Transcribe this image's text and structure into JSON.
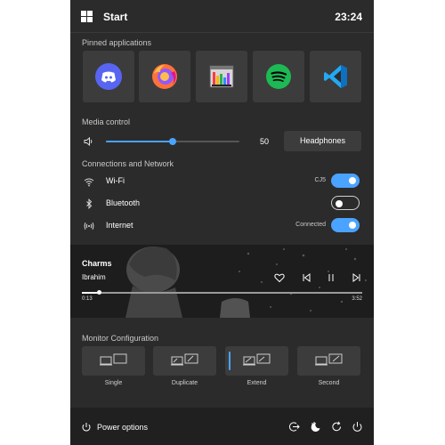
{
  "header": {
    "title": "Start",
    "time": "23:24",
    "icon": "windows-logo-icon"
  },
  "pinned": {
    "label": "Pinned applications",
    "apps": [
      {
        "name": "Discord",
        "icon": "discord-icon",
        "color": "#5865f2"
      },
      {
        "name": "Firefox",
        "icon": "firefox-icon",
        "color": "#ff7139"
      },
      {
        "name": "Task Manager",
        "icon": "task-manager-icon",
        "color": "#d6d6d6"
      },
      {
        "name": "Spotify",
        "icon": "spotify-icon",
        "color": "#1db954"
      },
      {
        "name": "Visual Studio Code",
        "icon": "vscode-icon",
        "color": "#23a9f2"
      }
    ]
  },
  "media": {
    "label": "Media control",
    "volume": 50,
    "volume_text": "50",
    "device": "Headphones"
  },
  "connections": {
    "label": "Connections and Network",
    "rows": [
      {
        "label": "Wi-Fi",
        "status": "CJ5",
        "on": true,
        "icon": "wifi-icon"
      },
      {
        "label": "Bluetooth",
        "status": "",
        "on": false,
        "icon": "bluetooth-icon"
      },
      {
        "label": "Internet",
        "status": "Connected",
        "on": true,
        "icon": "internet-icon"
      }
    ]
  },
  "player": {
    "song": "Charms",
    "artist": "Ibrahim",
    "current": "0:13",
    "total": "3:52",
    "progress": 0.06
  },
  "monitor": {
    "label": "Monitor Configuration",
    "options": [
      {
        "label": "Single",
        "active": false
      },
      {
        "label": "Duplicate",
        "active": false
      },
      {
        "label": "Extend",
        "active": true
      },
      {
        "label": "Second",
        "active": false
      }
    ]
  },
  "footer": {
    "power_label": "Power options"
  },
  "colors": {
    "accent": "#4aa3ff",
    "panel": "#2b2b2b",
    "tile": "#3c3c3c"
  }
}
